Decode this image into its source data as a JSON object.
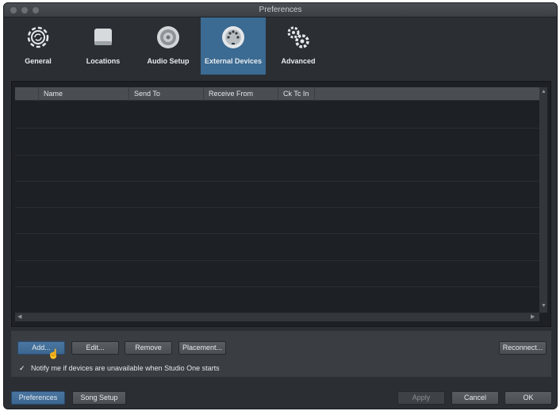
{
  "window": {
    "title": "Preferences"
  },
  "toolbar": {
    "items": [
      {
        "label": "General",
        "icon": "gear-refresh-icon"
      },
      {
        "label": "Locations",
        "icon": "drive-icon"
      },
      {
        "label": "Audio Setup",
        "icon": "speaker-icon"
      },
      {
        "label": "External Devices",
        "icon": "midi-port-icon",
        "active": true
      },
      {
        "label": "Advanced",
        "icon": "gears-icon"
      }
    ]
  },
  "table": {
    "columns": [
      "Name",
      "Send To",
      "Receive From",
      "Ck Tc In"
    ],
    "rows": []
  },
  "actions": {
    "add": "Add...",
    "edit": "Edit...",
    "remove": "Remove",
    "placement": "Placement...",
    "reconnect": "Reconnect..."
  },
  "notify": {
    "label": "Notify me if devices are unavailable when Studio One starts",
    "checked": true
  },
  "footer": {
    "preferences": "Preferences",
    "song_setup": "Song Setup",
    "apply": "Apply",
    "cancel": "Cancel",
    "ok": "OK"
  },
  "colors": {
    "accent": "#3b6a92",
    "background": "#2b2f34"
  }
}
